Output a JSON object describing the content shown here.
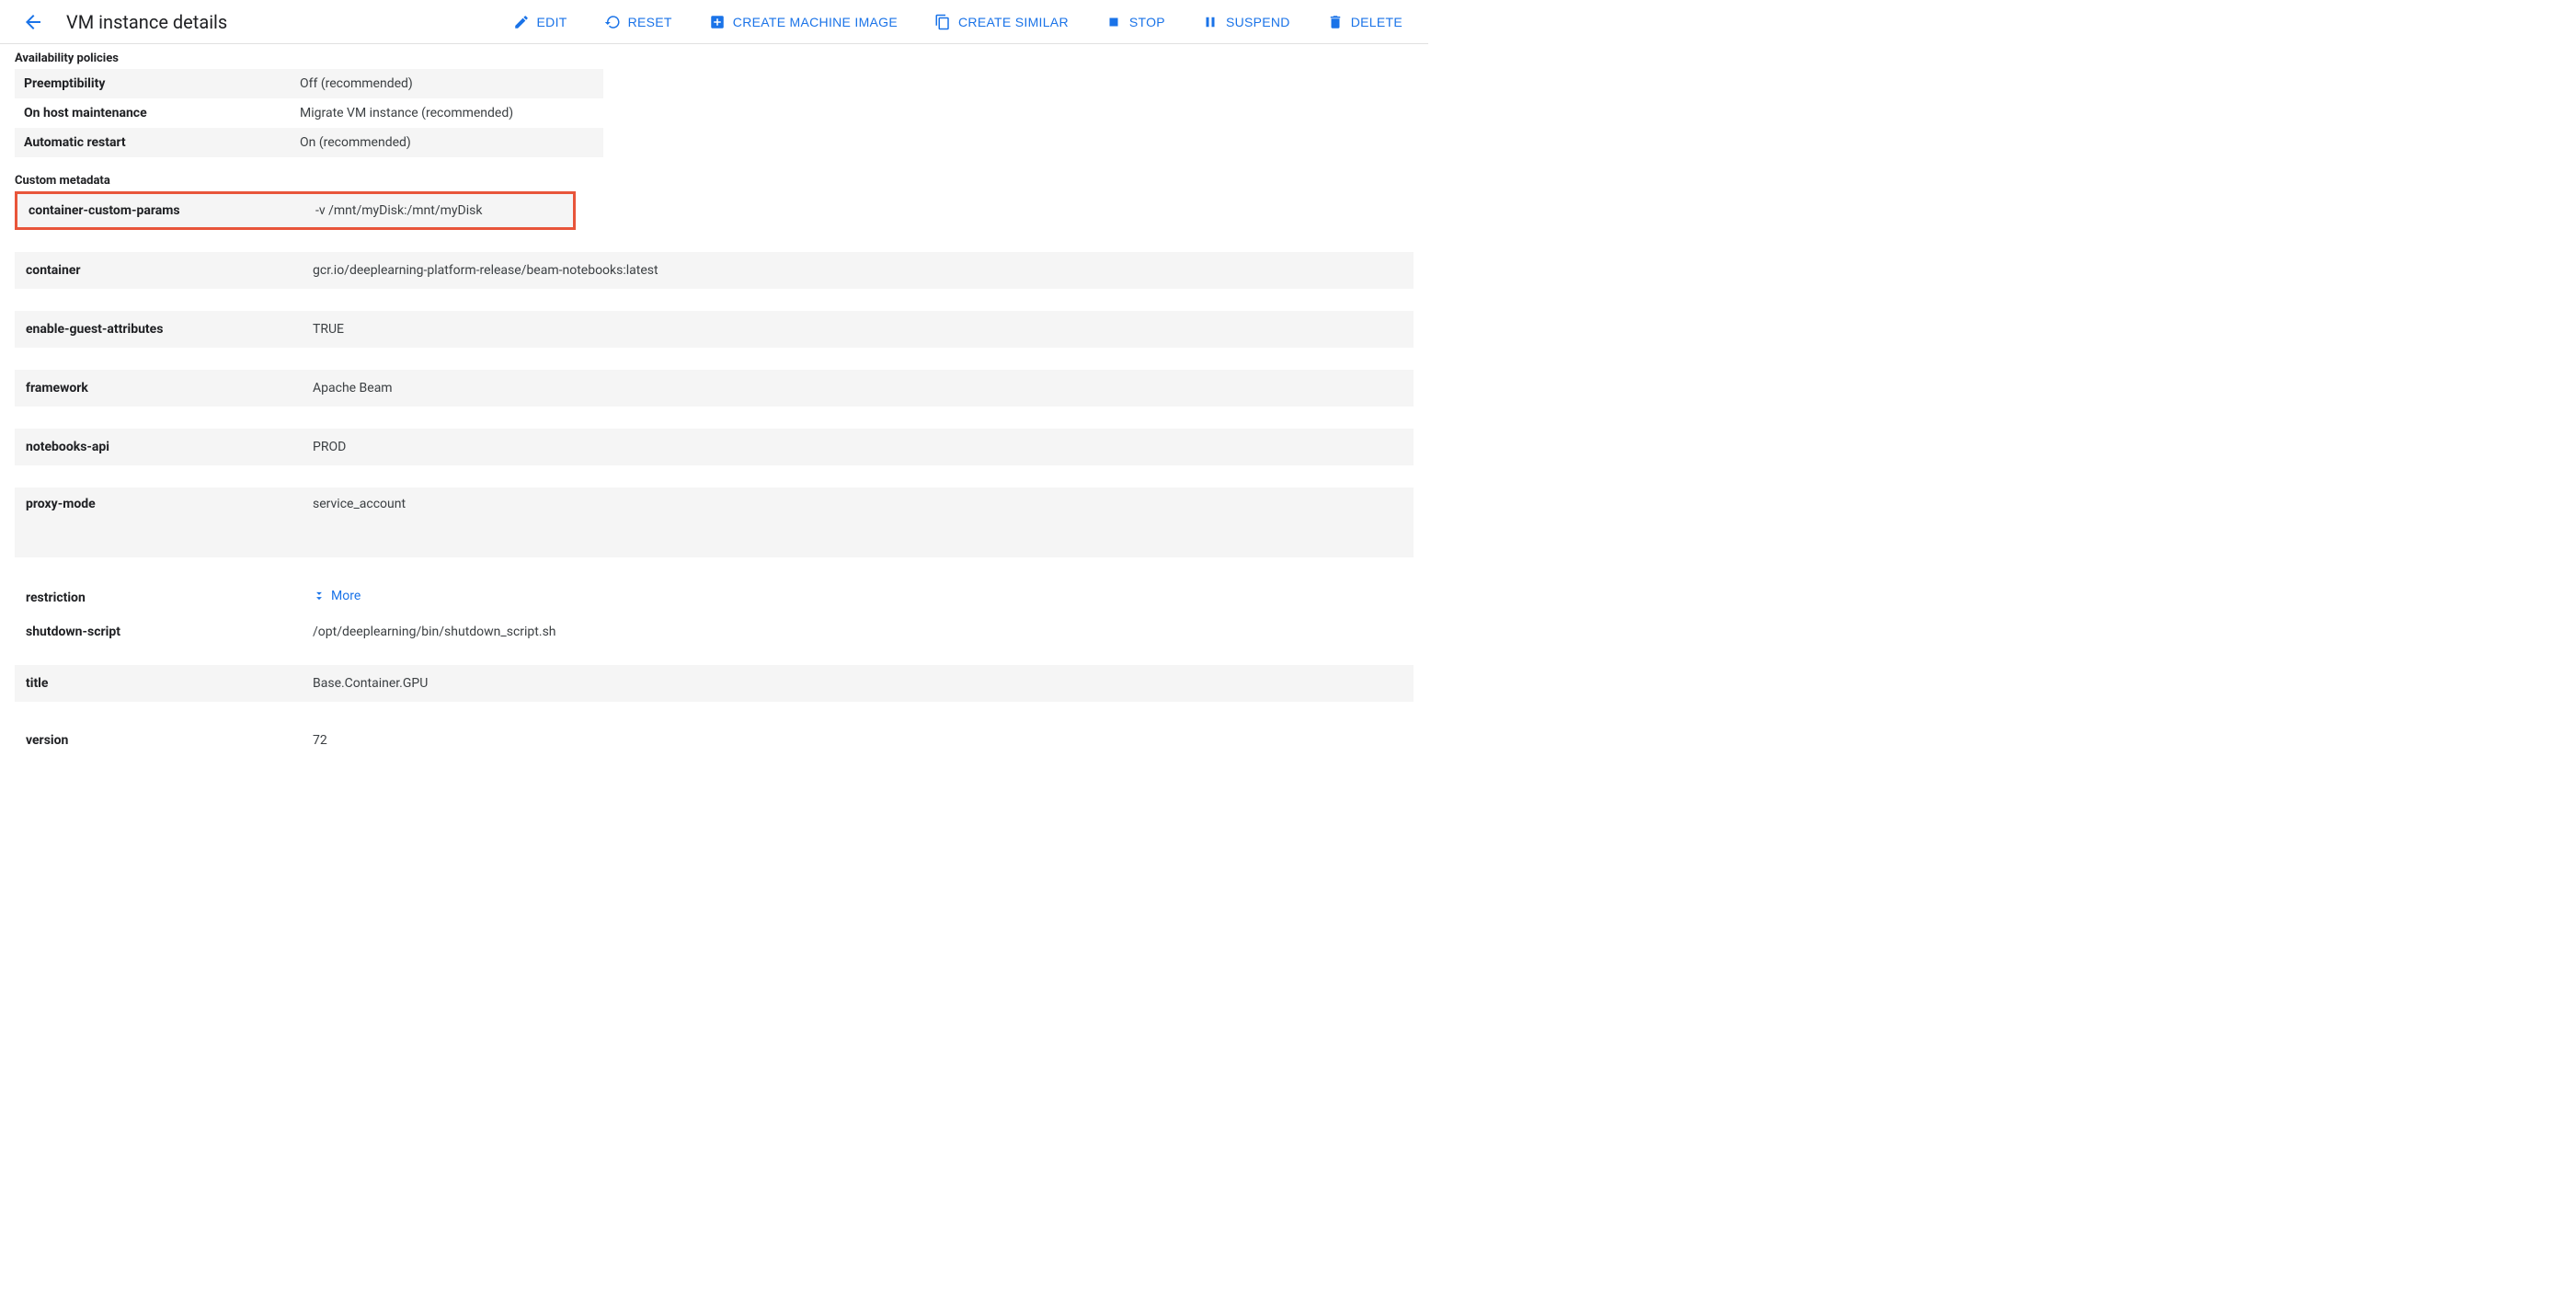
{
  "header": {
    "title": "VM instance details",
    "actions": {
      "edit": "EDIT",
      "reset": "RESET",
      "create_machine_image": "CREATE MACHINE IMAGE",
      "create_similar": "CREATE SIMILAR",
      "stop": "STOP",
      "suspend": "SUSPEND",
      "delete": "DELETE"
    }
  },
  "sections": {
    "availability": {
      "title": "Availability policies",
      "rows": [
        {
          "key": "Preemptibility",
          "val": "Off (recommended)"
        },
        {
          "key": "On host maintenance",
          "val": "Migrate VM instance (recommended)"
        },
        {
          "key": "Automatic restart",
          "val": "On (recommended)"
        }
      ]
    },
    "metadata": {
      "title": "Custom metadata",
      "rows": [
        {
          "key": "container-custom-params",
          "val": "-v /mnt/myDisk:/mnt/myDisk"
        },
        {
          "key": "container",
          "val": "gcr.io/deeplearning-platform-release/beam-notebooks:latest"
        },
        {
          "key": "enable-guest-attributes",
          "val": "TRUE"
        },
        {
          "key": "framework",
          "val": "Apache Beam"
        },
        {
          "key": "notebooks-api",
          "val": "PROD"
        },
        {
          "key": "proxy-mode",
          "val": "service_account"
        },
        {
          "key": "restriction",
          "val": "More"
        },
        {
          "key": "shutdown-script",
          "val": "/opt/deeplearning/bin/shutdown_script.sh"
        },
        {
          "key": "title",
          "val": "Base.Container.GPU"
        },
        {
          "key": "version",
          "val": "72"
        }
      ]
    }
  },
  "highlight_index": 0,
  "colors": {
    "primary": "#1a73e8",
    "highlight_border": "#e8553a"
  }
}
